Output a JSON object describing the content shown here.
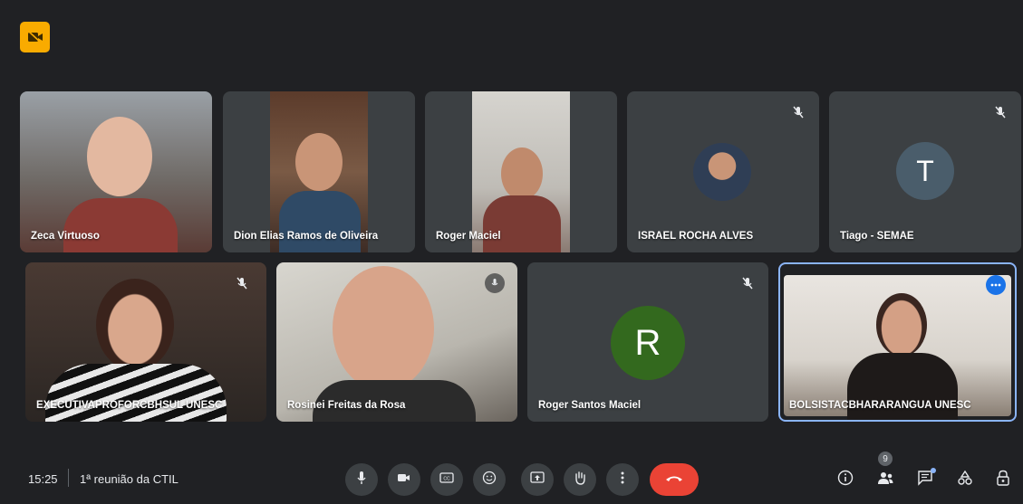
{
  "participants": [
    {
      "name": "Zeca Virtuoso"
    },
    {
      "name": "Dion Elias Ramos de Oliveira"
    },
    {
      "name": "Roger Maciel"
    },
    {
      "name": "ISRAEL ROCHA ALVES"
    },
    {
      "name": "Tiago - SEMAE",
      "initial": "T"
    },
    {
      "name": "EXECUTIVAPROFORCBHSUL UNESC"
    },
    {
      "name": "Rosinei Freitas da Rosa"
    },
    {
      "name": "Roger Santos Maciel",
      "initial": "R"
    },
    {
      "name": "BOLSISTACBHARARANGUA UNESC"
    }
  ],
  "footer": {
    "time": "15:25",
    "meeting_title": "1ª reunião da CTIL",
    "people_count": "9"
  },
  "colors": {
    "background": "#202124",
    "tile": "#3c4043",
    "tiago_avatar": "#4a5d6b",
    "roger_avatar": "#33691e",
    "end_call": "#ea4335",
    "active_border": "#8ab4f8",
    "accent_badge": "#f9ab00"
  },
  "icons": [
    "meet-badge-icon",
    "mic-muted-icon",
    "mic-icon",
    "camera-icon",
    "captions-icon",
    "emoji-icon",
    "present-icon",
    "raise-hand-icon",
    "more-options-icon",
    "end-call-icon",
    "info-icon",
    "people-icon",
    "chat-icon",
    "activities-icon",
    "host-controls-icon"
  ]
}
